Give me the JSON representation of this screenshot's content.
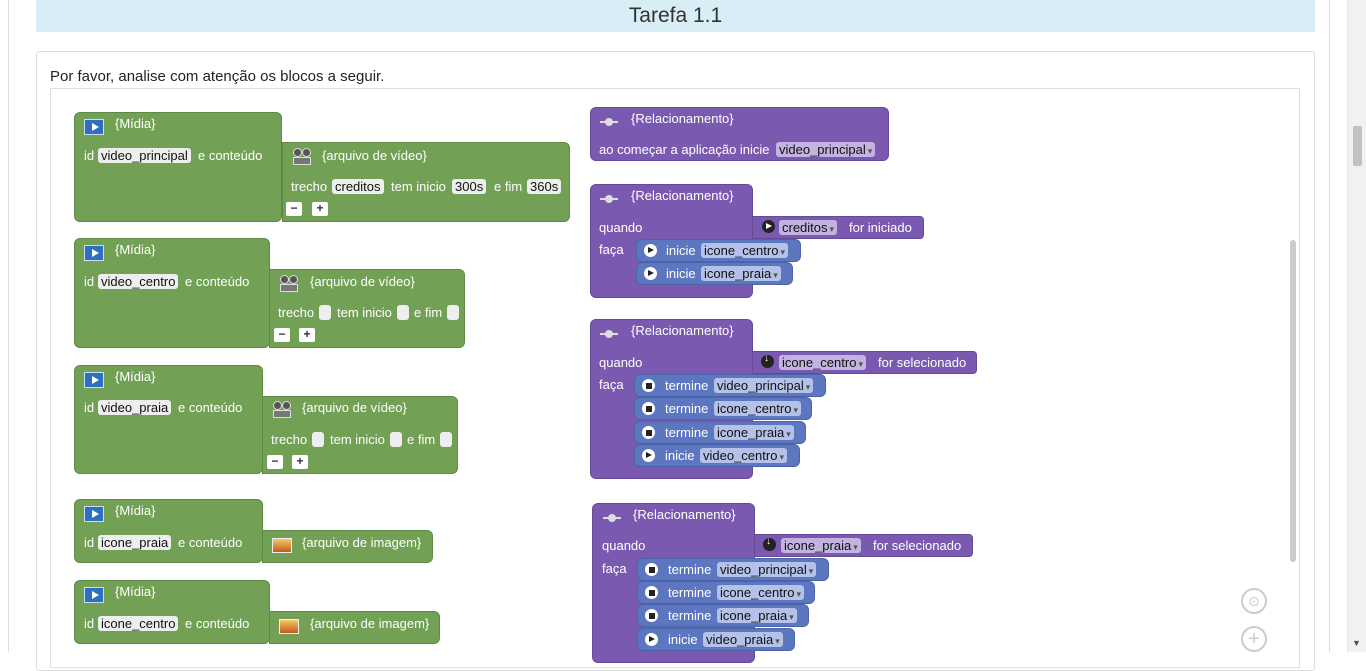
{
  "page": {
    "title": "Tarefa 1.1",
    "prompt": "Por favor, analise com atenção os blocos a seguir."
  },
  "media_blocks": [
    {
      "header": "{Mídia}",
      "id_label": "id",
      "id_value": "video_principal",
      "content_label": "e conteúdo",
      "type_label": "{arquivo de vídeo}",
      "trecho_label": "trecho",
      "trecho_value": "creditos",
      "inicio_label": "tem inicio",
      "inicio_value": "300s",
      "fim_label": "e fim",
      "fim_value": "360s",
      "minus": "−",
      "plus": "+"
    },
    {
      "header": "{Mídia}",
      "id_label": "id",
      "id_value": "video_centro",
      "content_label": "e conteúdo",
      "type_label": "{arquivo de vídeo}",
      "trecho_label": "trecho",
      "inicio_label": "tem inicio",
      "fim_label": "e fim",
      "minus": "−",
      "plus": "+"
    },
    {
      "header": "{Mídia}",
      "id_label": "id",
      "id_value": "video_praia",
      "content_label": "e conteúdo",
      "type_label": "{arquivo de vídeo}",
      "trecho_label": "trecho",
      "inicio_label": "tem inicio",
      "fim_label": "e fim",
      "minus": "−",
      "plus": "+"
    },
    {
      "header": "{Mídia}",
      "id_label": "id",
      "id_value": "icone_praia",
      "content_label": "e conteúdo",
      "type_label": "{arquivo de imagem}"
    },
    {
      "header": "{Mídia}",
      "id_label": "id",
      "id_value": "icone_centro",
      "content_label": "e conteúdo",
      "type_label": "{arquivo de imagem}"
    }
  ],
  "relation_blocks": [
    {
      "header": "{Relacionamento}",
      "start_label": "ao começar a aplicação inicie",
      "start_value": "video_principal"
    },
    {
      "header": "{Relacionamento}",
      "when_label": "quando",
      "do_label": "faça",
      "cond_value": "creditos",
      "cond_event": "for iniciado",
      "actions": [
        {
          "verb": "inicie",
          "target": "icone_centro"
        },
        {
          "verb": "inicie",
          "target": "icone_praia"
        }
      ]
    },
    {
      "header": "{Relacionamento}",
      "when_label": "quando",
      "do_label": "faça",
      "cond_value": "icone_centro",
      "cond_event": "for selecionado",
      "actions": [
        {
          "verb": "termine",
          "target": "video_principal"
        },
        {
          "verb": "termine",
          "target": "icone_centro"
        },
        {
          "verb": "termine",
          "target": "icone_praia"
        },
        {
          "verb": "inicie",
          "target": "video_centro"
        }
      ]
    },
    {
      "header": "{Relacionamento}",
      "when_label": "quando",
      "do_label": "faça",
      "cond_value": "icone_praia",
      "cond_event": "for selecionado",
      "actions": [
        {
          "verb": "termine",
          "target": "video_principal"
        },
        {
          "verb": "termine",
          "target": "icone_centro"
        },
        {
          "verb": "termine",
          "target": "icone_praia"
        },
        {
          "verb": "inicie",
          "target": "video_praia"
        }
      ]
    }
  ],
  "dropdown_arrow": "▾",
  "colors": {
    "media": "#72a155",
    "relation": "#7a5ab0",
    "action": "#5c76c0",
    "title_bg": "#d9edf7"
  }
}
